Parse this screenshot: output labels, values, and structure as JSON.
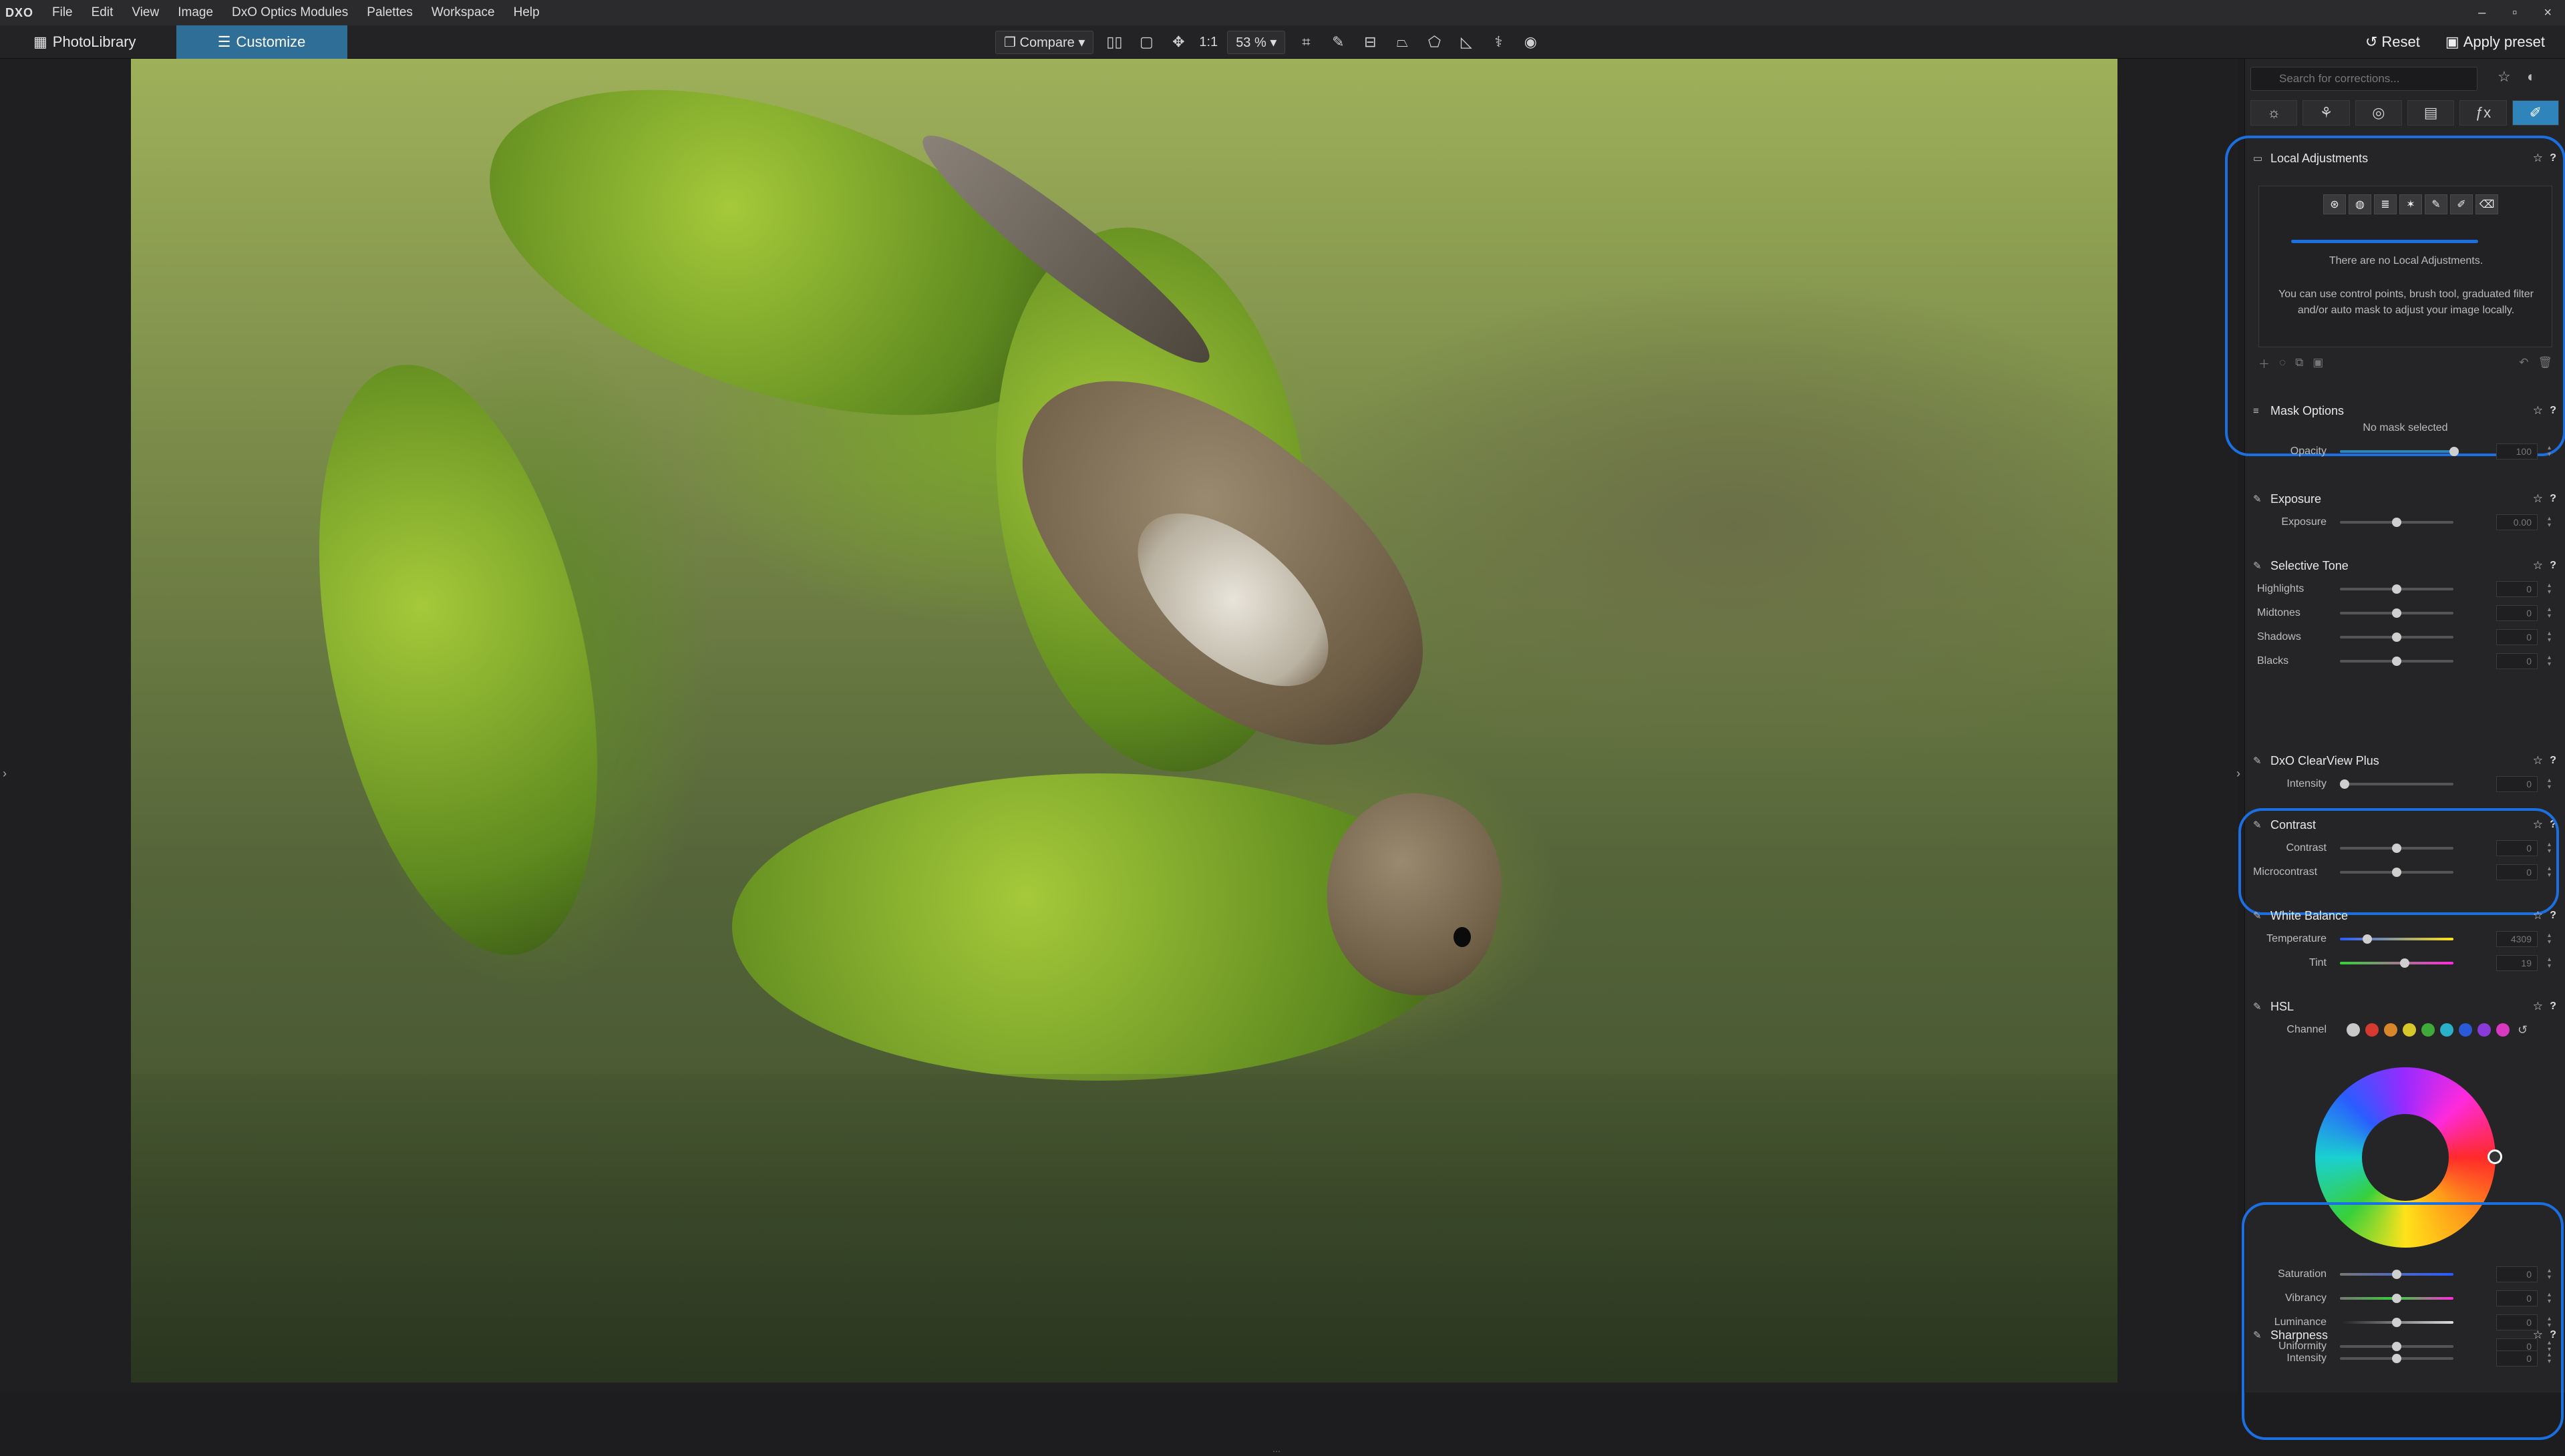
{
  "app": {
    "logo": "DXO"
  },
  "menu": [
    "File",
    "Edit",
    "View",
    "Image",
    "DxO Optics Modules",
    "Palettes",
    "Workspace",
    "Help"
  ],
  "window_controls": [
    "–",
    "▫",
    "×"
  ],
  "tabs": {
    "photolibrary": "PhotoLibrary",
    "customize": "Customize"
  },
  "toolbar": {
    "compare": "Compare",
    "one_to_one": "1:1",
    "zoom": "53 %",
    "reset": "Reset",
    "apply_preset": "Apply preset"
  },
  "search": {
    "placeholder": "Search for corrections..."
  },
  "local_adjustments": {
    "title": "Local Adjustments",
    "empty_title": "There are no Local Adjustments.",
    "empty_text": "You can use control points, brush tool, graduated filter and/or auto mask to adjust your image locally."
  },
  "mask_options": {
    "title": "Mask Options",
    "status": "No mask selected",
    "opacity_label": "Opacity",
    "opacity_value": "100"
  },
  "exposure": {
    "title": "Exposure",
    "label": "Exposure",
    "value": "0.00"
  },
  "selective_tone": {
    "title": "Selective Tone",
    "rows": [
      {
        "label": "Highlights",
        "value": "0"
      },
      {
        "label": "Midtones",
        "value": "0"
      },
      {
        "label": "Shadows",
        "value": "0"
      },
      {
        "label": "Blacks",
        "value": "0"
      }
    ]
  },
  "clearview": {
    "title": "DxO ClearView Plus",
    "label": "Intensity",
    "value": "0"
  },
  "contrast": {
    "title": "Contrast",
    "rows": [
      {
        "label": "Contrast",
        "value": "0"
      },
      {
        "label": "Microcontrast",
        "value": "0"
      }
    ]
  },
  "white_balance": {
    "title": "White Balance",
    "rows": [
      {
        "label": "Temperature",
        "value": "4309"
      },
      {
        "label": "Tint",
        "value": "19"
      }
    ]
  },
  "hsl": {
    "title": "HSL",
    "channel_label": "Channel",
    "channel_colors": [
      "#c8c8c8",
      "#d43a2f",
      "#d9852a",
      "#d7c72a",
      "#3faa3a",
      "#2ab0c8",
      "#2a5ad7",
      "#8a3ad7",
      "#d73ac0"
    ],
    "rows": [
      {
        "label": "Saturation",
        "value": "0"
      },
      {
        "label": "Vibrancy",
        "value": "0"
      },
      {
        "label": "Luminance",
        "value": "0"
      },
      {
        "label": "Uniformity",
        "value": "0"
      }
    ]
  },
  "sharpness": {
    "title": "Sharpness",
    "label": "Intensity",
    "value": "0"
  },
  "accent": "#2f84bb",
  "annotation_color": "#1b6fe0"
}
